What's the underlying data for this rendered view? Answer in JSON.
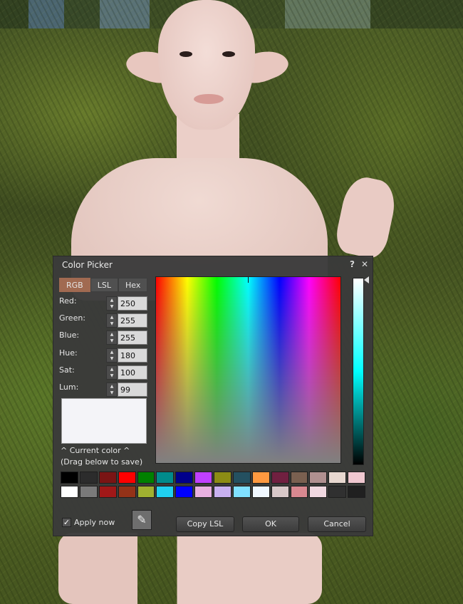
{
  "window": {
    "title": "Color Picker",
    "help_glyph": "?",
    "close_glyph": "✕"
  },
  "tabs": [
    {
      "label": "RGB",
      "active": true
    },
    {
      "label": "LSL",
      "active": false
    },
    {
      "label": "Hex",
      "active": false
    }
  ],
  "fields": {
    "red": {
      "label": "Red:",
      "value": "250"
    },
    "green": {
      "label": "Green:",
      "value": "255"
    },
    "blue": {
      "label": "Blue:",
      "value": "255"
    },
    "hue": {
      "label": "Hue:",
      "value": "180"
    },
    "sat": {
      "label": "Sat:",
      "value": "100"
    },
    "lum": {
      "label": "Lum:",
      "value": "99"
    }
  },
  "spinner": {
    "up": "▲",
    "down": "▼"
  },
  "current_color": {
    "color": "#f4f4f8",
    "label": "^ Current color ^",
    "sub": "(Drag below to save)"
  },
  "palette": {
    "row1": [
      "#000000",
      "#2c2c2c",
      "#7a1414",
      "#ff0000",
      "#008000",
      "#008b8b",
      "#00008b",
      "#c040ff",
      "#8c8c14",
      "#245060",
      "#ff9940",
      "#702040",
      "#7a6050",
      "#b09090",
      "#e8d8d0",
      "#f0c8d0"
    ],
    "row2": [
      "#ffffff",
      "#7a7a7a",
      "#a01818",
      "#943218",
      "#a0b030",
      "#20d0f0",
      "#0000ff",
      "#e8b0e0",
      "#c8b0f0",
      "#80e0ff",
      "#f0f8ff",
      "#d8c8c8",
      "#d88890",
      "#f0d8e0",
      "#303030",
      "#202020"
    ]
  },
  "apply_now": {
    "label": "Apply now",
    "checked": true,
    "glyph": "✓"
  },
  "eyedropper": {
    "glyph": "✎"
  },
  "buttons": {
    "copy": "Copy LSL",
    "ok": "OK",
    "cancel": "Cancel"
  }
}
